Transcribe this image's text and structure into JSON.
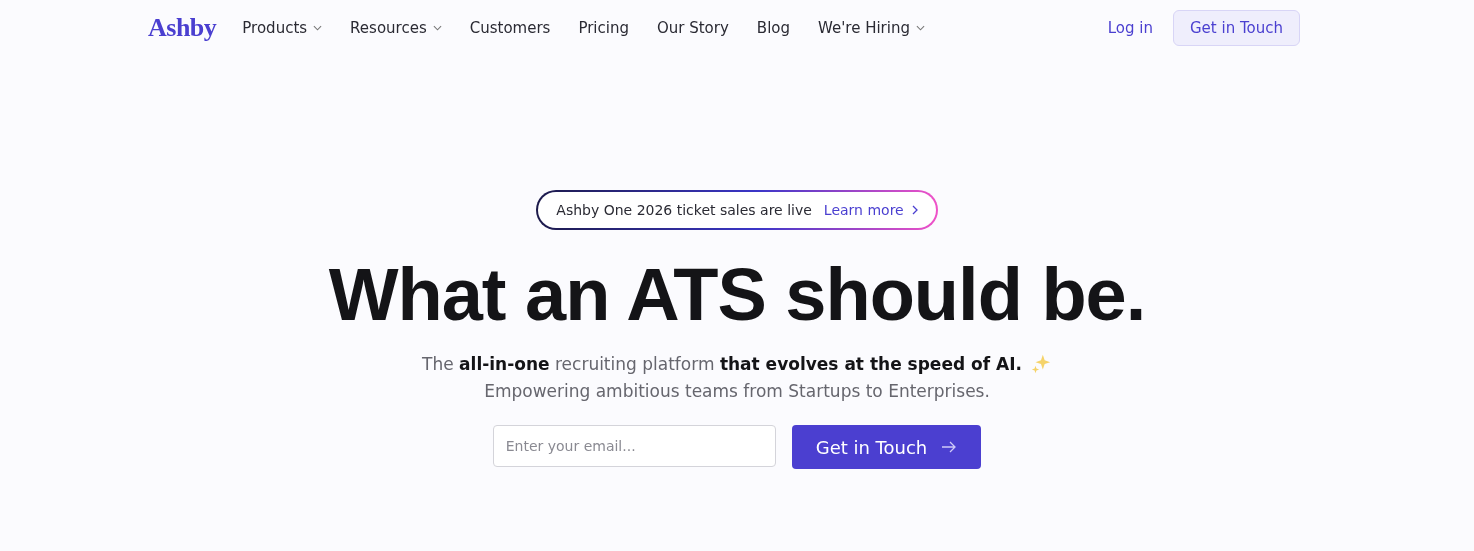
{
  "nav": {
    "logo": "Ashby",
    "items": [
      {
        "label": "Products",
        "dropdown": true
      },
      {
        "label": "Resources",
        "dropdown": true
      },
      {
        "label": "Customers",
        "dropdown": false
      },
      {
        "label": "Pricing",
        "dropdown": false
      },
      {
        "label": "Our Story",
        "dropdown": false
      },
      {
        "label": "Blog",
        "dropdown": false
      },
      {
        "label": "We're Hiring",
        "dropdown": true
      }
    ],
    "login": "Log in",
    "cta": "Get in Touch"
  },
  "hero": {
    "announcement": {
      "text": "Ashby One 2026 ticket sales are live",
      "link": "Learn more"
    },
    "headline": "What an ATS should be.",
    "subtitle": [
      "The **all-in-one** recruiting platform **that evolves at the speed of AI.**",
      "Empowering ambitious teams from Startups to Enterprises."
    ],
    "email": {
      "placeholder": "Enter your email..."
    },
    "cta": "Get in Touch"
  }
}
